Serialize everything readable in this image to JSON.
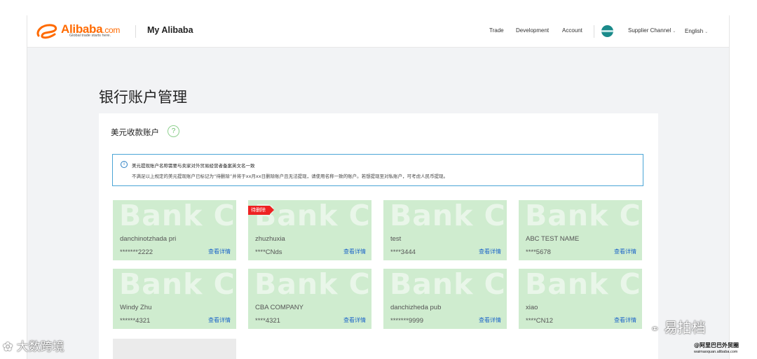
{
  "header": {
    "logo_text": "Alibaba",
    "logo_suffix": ".com",
    "logo_tagline": "Global trade starts here.",
    "app_title": "My Alibaba",
    "nav": [
      "Trade",
      "Development",
      "Account"
    ],
    "supplier_channel": "Supplier Channel",
    "language": "English",
    "icons": {
      "dropdown": "chevron-down-icon",
      "avatar": "avatar"
    }
  },
  "page": {
    "title": "银行账户管理",
    "section_title": "美元收款账户",
    "help_glyph": "?",
    "notice": {
      "line1": "美元提现账户名称需要与卖家对外贸易经营者备案英文名一致",
      "line2": "不满足以上规定的美元提现账户已标记为“待删除”并将于xx月xx日删除账户且无法提现，请使用名称一致的账户。若想提现至对私账户，可考虑人民币提现。"
    }
  },
  "cards": [
    {
      "bg_text": "Bank Ca",
      "name": "danchinotzhada pri",
      "number": "*******2222",
      "link": "查看详情",
      "badge": ""
    },
    {
      "bg_text": "Bank Ca",
      "name": "zhuzhuxia",
      "number": "****CNds",
      "link": "查看详情",
      "badge": "待删除"
    },
    {
      "bg_text": "Bank Ca",
      "name": "test",
      "number": "****3444",
      "link": "查看详情",
      "badge": ""
    },
    {
      "bg_text": "Bank Ca",
      "name": "ABC TEST NAME",
      "number": "****5678",
      "link": "查看详情",
      "badge": ""
    },
    {
      "bg_text": "Bank Ca",
      "name": "Windy Zhu",
      "number": "******4321",
      "link": "查看详情",
      "badge": ""
    },
    {
      "bg_text": "Bank Ca",
      "name": "CBA COMPANY",
      "number": "****4321",
      "link": "查看详情",
      "badge": ""
    },
    {
      "bg_text": "Bank Ca",
      "name": "danchizheda pub",
      "number": "*******9999",
      "link": "查看详情",
      "badge": ""
    },
    {
      "bg_text": "Bank Ca",
      "name": "xiao",
      "number": "****CN12",
      "link": "查看详情",
      "badge": ""
    }
  ],
  "watermarks": {
    "left": "大数跨境",
    "right_logo": "易拍档",
    "right_line1": "@阿里巴巴外贸圈",
    "right_line2": "waimaoquan.alibaba.com"
  },
  "colors": {
    "brand": "#ff6a00",
    "card_bg": "#cfeccf",
    "link": "#1e66c8",
    "badge": "#ee2222",
    "notice_border": "#4aa5d6"
  }
}
